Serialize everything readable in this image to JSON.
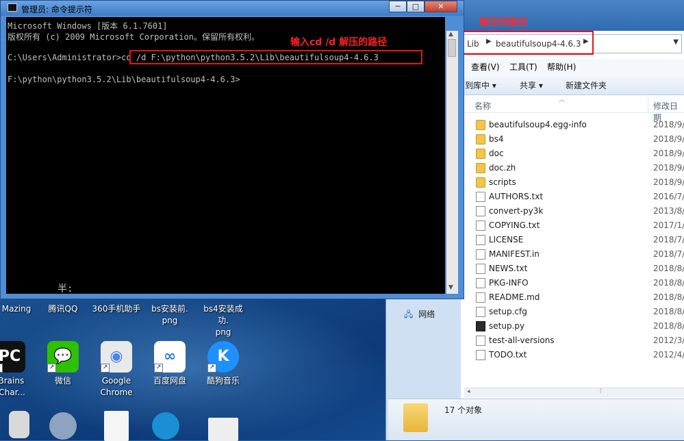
{
  "cmd": {
    "title": "管理员: 命令提示符",
    "min_label": "─",
    "max_label": "□",
    "close_label": "✕",
    "lines": [
      "Microsoft Windows [版本 6.1.7601]",
      "版权所有 (c) 2009 Microsoft Corporation。保留所有权利。",
      "",
      "C:\\Users\\Administrator>cd /d F:\\python\\python3.5.2\\Lib\\beautifulsoup4-4.6.3",
      "",
      "F:\\python\\python3.5.2\\Lib\\beautifulsoup4-4.6.3>"
    ],
    "annotation": "输入cd /d 解压的路径",
    "ime_text": "半:"
  },
  "explorer": {
    "annotation": "解压的路径",
    "breadcrumb": [
      "Lib",
      "beautifulsoup4-4.6.3"
    ],
    "menu": [
      "查看(V)",
      "工具(T)",
      "帮助(H)"
    ],
    "toolbar": [
      "到库中 ▾",
      "共享 ▾",
      "新建文件夹"
    ],
    "columns": {
      "name": "名称",
      "date": "修改日期"
    },
    "files": [
      {
        "name": "beautifulsoup4.egg-info",
        "date": "2018/9/",
        "type": "folder"
      },
      {
        "name": "bs4",
        "date": "2018/9/",
        "type": "folder"
      },
      {
        "name": "doc",
        "date": "2018/9/",
        "type": "folder"
      },
      {
        "name": "doc.zh",
        "date": "2018/9/",
        "type": "folder"
      },
      {
        "name": "scripts",
        "date": "2018/9/",
        "type": "folder"
      },
      {
        "name": "AUTHORS.txt",
        "date": "2016/7/",
        "type": "file"
      },
      {
        "name": "convert-py3k",
        "date": "2013/8/",
        "type": "file"
      },
      {
        "name": "COPYING.txt",
        "date": "2017/1/",
        "type": "file"
      },
      {
        "name": "LICENSE",
        "date": "2018/7/",
        "type": "file"
      },
      {
        "name": "MANIFEST.in",
        "date": "2018/7/",
        "type": "file"
      },
      {
        "name": "NEWS.txt",
        "date": "2018/8/",
        "type": "file"
      },
      {
        "name": "PKG-INFO",
        "date": "2018/8/",
        "type": "file"
      },
      {
        "name": "README.md",
        "date": "2018/8/",
        "type": "file"
      },
      {
        "name": "setup.cfg",
        "date": "2018/8/",
        "type": "file"
      },
      {
        "name": "setup.py",
        "date": "2018/8/",
        "type": "py"
      },
      {
        "name": "test-all-versions",
        "date": "2012/3/",
        "type": "file"
      },
      {
        "name": "TODO.txt",
        "date": "2012/4/",
        "type": "file"
      }
    ],
    "nav_network": "网络",
    "status": "17 个对象"
  },
  "desktop": {
    "icons_row1": [
      {
        "label": "Mazing",
        "name": "imazing"
      },
      {
        "label": "腾讯QQ",
        "name": "tencent-qq"
      },
      {
        "label": "360手机助手",
        "name": "360-phone-assistant"
      },
      {
        "label": "bs安装前.\npng",
        "name": "bs-before-png"
      },
      {
        "label": "bs4安装成功.\npng",
        "name": "bs4-success-png"
      }
    ],
    "icons_row2": [
      {
        "label": "tBrains\nyChar...",
        "name": "jetbrains-pycharm",
        "glyph": "PC",
        "color": "#1a1a1a"
      },
      {
        "label": "微信",
        "name": "wechat",
        "glyph": "💬",
        "color": "#2dc100"
      },
      {
        "label": "Google\nChrome",
        "name": "google-chrome",
        "glyph": "◉",
        "color": "#ffffff"
      },
      {
        "label": "百度网盘",
        "name": "baidu-netdisk",
        "glyph": "∞",
        "color": "#ffffff"
      },
      {
        "label": "酷狗音乐",
        "name": "kugou-music",
        "glyph": "K",
        "color": "#1e90ff"
      }
    ],
    "colors": {
      "annotation": "#e8151b",
      "console_bg": "#000000",
      "console_fg": "#c0c0c0"
    }
  }
}
